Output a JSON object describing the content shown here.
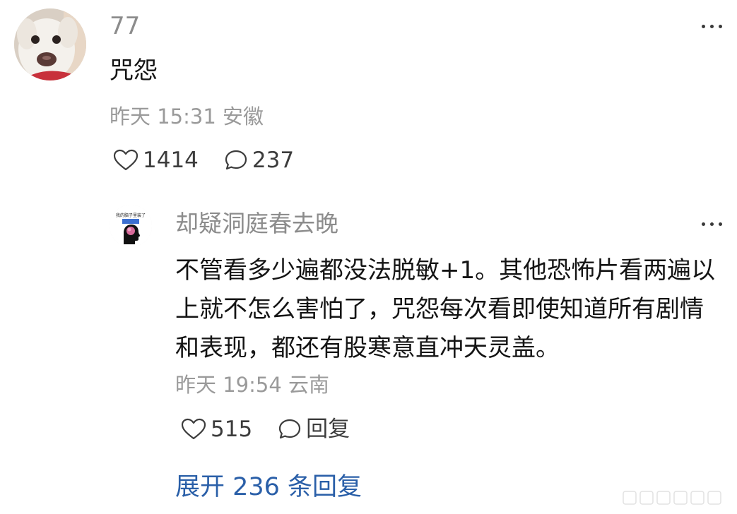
{
  "comment": {
    "username": "77",
    "text": "咒怨",
    "meta": "昨天 15:31 安徽",
    "like_count": "1414",
    "reply_count": "237",
    "more_icon": "more-dots-icon",
    "like_icon": "heart-icon",
    "reply_icon": "comment-bubble-icon"
  },
  "reply": {
    "username": "却疑洞庭春去晚",
    "avatar_text": "我的脑子里装了",
    "text": "不管看多少遍都没法脱敏+1。其他恐怖片看两遍以上就不怎么害怕了，咒怨每次看即使知道所有剧情和表现，都还有股寒意直冲天灵盖。",
    "meta": "昨天 19:54 云南",
    "like_count": "515",
    "reply_label": "回复"
  },
  "expand": {
    "label": "展开 236 条回复"
  },
  "colors": {
    "link": "#2a5fa8",
    "meta": "#9a9a9a",
    "username": "#8c8c8c"
  }
}
